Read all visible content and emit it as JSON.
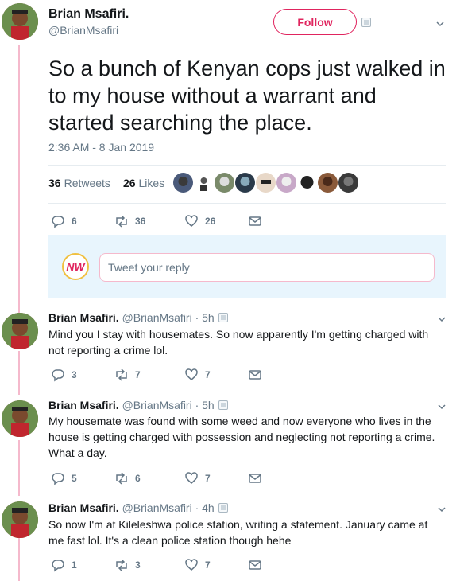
{
  "main_tweet": {
    "author_name": "Brian Msafiri.",
    "author_handle": "@BrianMsafiri",
    "follow_label": "Follow",
    "text": "So a bunch of Kenyan cops just walked in to my house without a warrant and started searching the place.",
    "timestamp": "2:36 AM - 8 Jan 2019",
    "retweets_count": "36",
    "retweets_label": "Retweets",
    "likes_count": "26",
    "likes_label": "Likes",
    "actions": {
      "replies": "6",
      "retweets": "36",
      "likes": "26"
    }
  },
  "reply_box": {
    "logo_text": "NW",
    "placeholder": "Tweet your reply"
  },
  "replies": [
    {
      "author_name": "Brian Msafiri.",
      "meta": "@BrianMsafiri · 5h",
      "text": "Mind you I stay with housemates. So now apparently I'm getting charged with not reporting a crime lol.",
      "actions": {
        "replies": "3",
        "retweets": "7",
        "likes": "7"
      }
    },
    {
      "author_name": "Brian Msafiri.",
      "meta": "@BrianMsafiri · 5h",
      "text": "My housemate was found with some weed and now everyone who lives in the house is getting charged with possession and neglecting not reporting a crime. What a day.",
      "actions": {
        "replies": "5",
        "retweets": "6",
        "likes": "7"
      }
    },
    {
      "author_name": "Brian Msafiri.",
      "meta": "@BrianMsafiri · 4h",
      "text": "So now I'm at Kileleshwa police station, writing a statement. January came at me fast lol. It's a clean police station though hehe",
      "actions": {
        "replies": "1",
        "retweets": "3",
        "likes": "7"
      }
    }
  ],
  "icons": {
    "reply": "reply-icon",
    "retweet": "retweet-icon",
    "like": "heart-icon",
    "dm": "envelope-icon",
    "caret": "chevron-down-icon",
    "blocked": "image-icon"
  },
  "colors": {
    "accent": "#e0245e",
    "thread_line": "#f5b9cc",
    "muted": "#657786",
    "reply_bg": "#e8f5fd"
  }
}
